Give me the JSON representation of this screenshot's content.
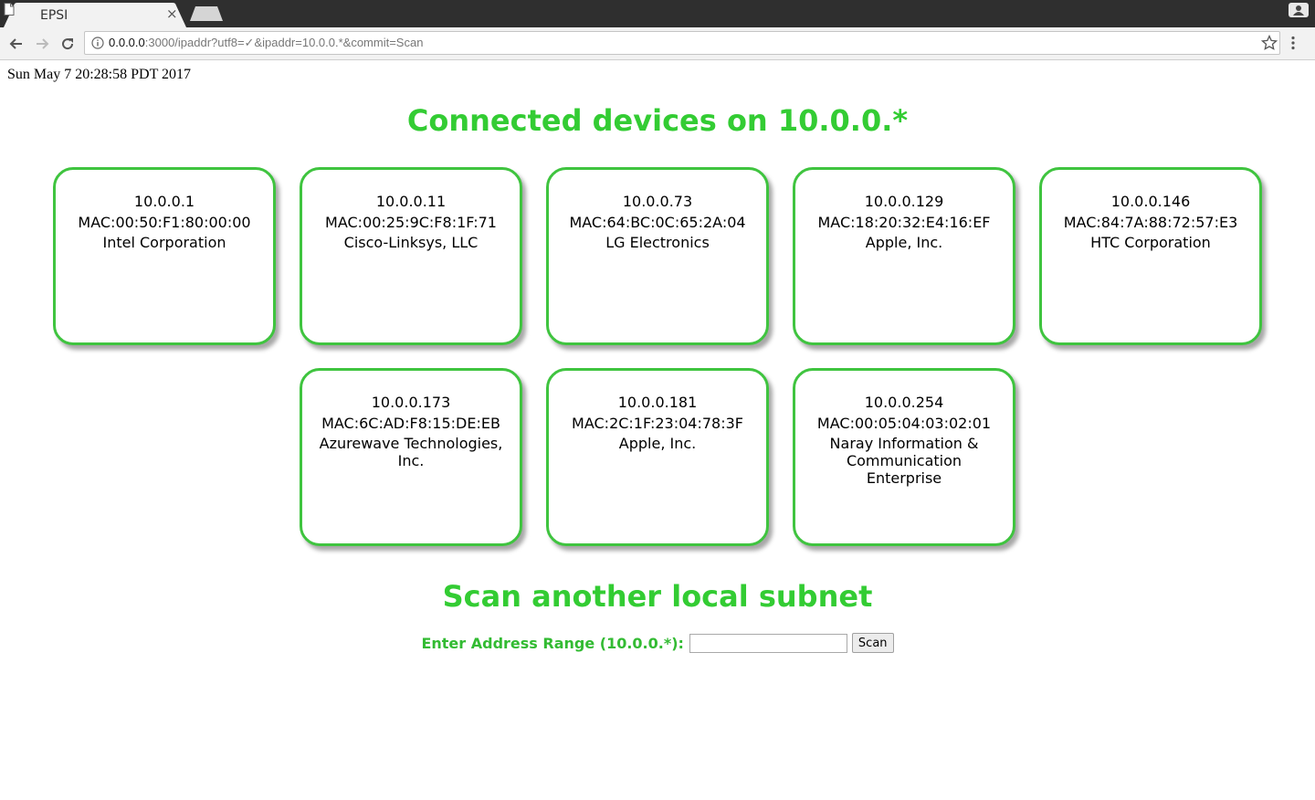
{
  "browser": {
    "tab_title": "EPSI",
    "tab_close": "×",
    "url_host": "0.0.0.0",
    "url_rest": ":3000/ipaddr?utf8=✓&ipaddr=10.0.0.*&commit=Scan",
    "icons": [
      "page-icon",
      "close-icon",
      "back-icon",
      "forward-icon",
      "reload-icon",
      "info-icon",
      "star-icon",
      "menu-icon",
      "profile-icon"
    ]
  },
  "page": {
    "timestamp": "Sun May 7 20:28:58 PDT 2017",
    "heading": "Connected devices on 10.0.0.*",
    "devices": [
      {
        "ip": "10.0.0.1",
        "mac": "MAC:00:50:F1:80:00:00",
        "vendor": "Intel Corporation"
      },
      {
        "ip": "10.0.0.11",
        "mac": "MAC:00:25:9C:F8:1F:71",
        "vendor": "Cisco-Linksys, LLC"
      },
      {
        "ip": "10.0.0.73",
        "mac": "MAC:64:BC:0C:65:2A:04",
        "vendor": "LG Electronics"
      },
      {
        "ip": "10.0.0.129",
        "mac": "MAC:18:20:32:E4:16:EF",
        "vendor": "Apple, Inc."
      },
      {
        "ip": "10.0.0.146",
        "mac": "MAC:84:7A:88:72:57:E3",
        "vendor": "HTC Corporation"
      },
      {
        "ip": "10.0.0.173",
        "mac": "MAC:6C:AD:F8:15:DE:EB",
        "vendor": "Azurewave Technologies, Inc."
      },
      {
        "ip": "10.0.0.181",
        "mac": "MAC:2C:1F:23:04:78:3F",
        "vendor": "Apple, Inc."
      },
      {
        "ip": "10.0.0.254",
        "mac": "MAC:00:05:04:03:02:01",
        "vendor": "Naray Information & Communication Enterprise"
      }
    ],
    "scan_heading": "Scan another local subnet",
    "form": {
      "label": "Enter Address Range (10.0.0.*):",
      "input_value": "",
      "button_label": "Scan"
    }
  },
  "colors": {
    "accent": "#33cc33",
    "card_border": "#3fc43f"
  }
}
